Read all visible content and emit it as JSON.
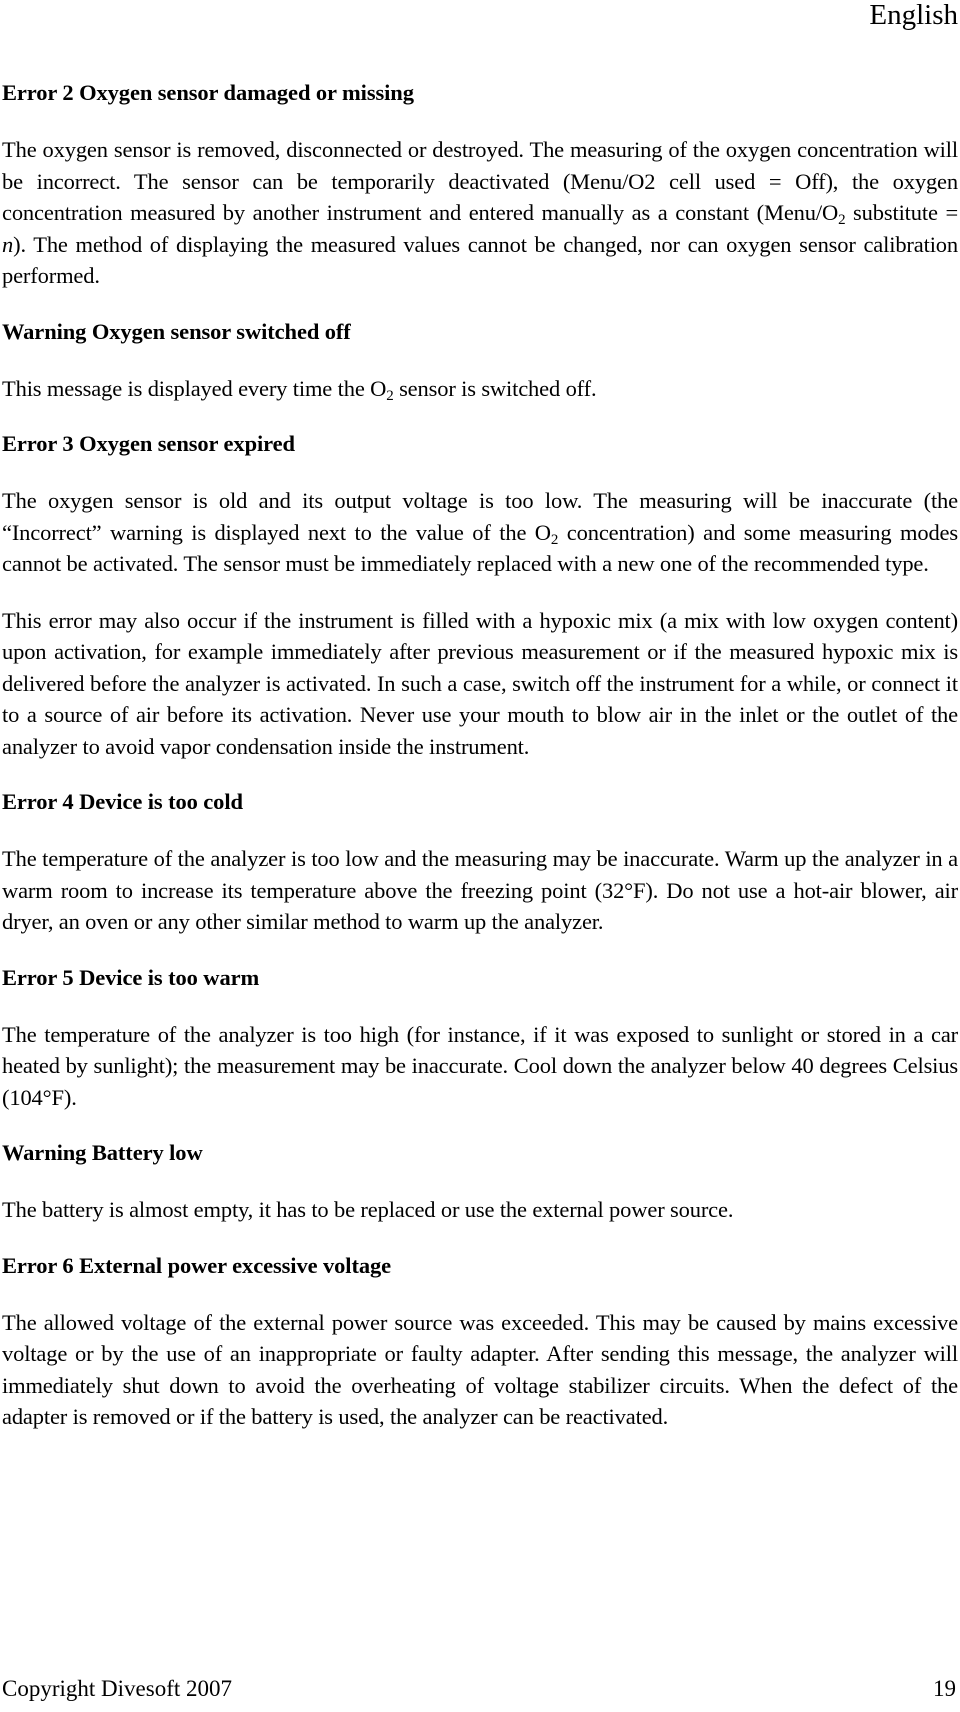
{
  "header": {
    "language": "English"
  },
  "sections": [
    {
      "heading": "Error 2 Oxygen sensor damaged or missing",
      "paragraphs": [
        {
          "p1": "The oxygen sensor is removed, disconnected or destroyed. The measuring of the oxygen concentration will be incorrect. The sensor can be temporarily deactivated (Menu/O2 cell used = Off), the oxygen concentration measured by another instrument and entered manually as a constant (Menu/O",
          "sub": "2",
          "p2": " substitute = ",
          "italic": "n",
          "p3": "). The method of displaying the measured values cannot be changed, nor can oxygen sensor calibration performed."
        }
      ]
    },
    {
      "heading": "Warning Oxygen sensor switched off",
      "paragraphs": [
        {
          "p1": "This message is displayed every time the O",
          "sub": "2",
          "p2": " sensor is switched off."
        }
      ]
    },
    {
      "heading": "Error 3 Oxygen sensor expired",
      "paragraphs": [
        {
          "p1": "The oxygen sensor is old and its output voltage is too low. The measuring will be inaccurate (the “Incorrect” warning is displayed next to the value of the O",
          "sub": "2",
          "p2": " concentration) and some measuring modes cannot be activated. The sensor must be immediately replaced with a new one of the recommended type."
        },
        {
          "p1": "This error may also occur if the instrument is filled with a hypoxic mix (a mix with low oxygen content) upon activation, for example immediately after previous measurement or if the measured hypoxic mix is delivered before the analyzer is activated. In such a case, switch off the instrument for a while, or connect it to a source of air before its activation. Never use your mouth to blow air in the inlet or the outlet of the analyzer to avoid vapor condensation inside the instrument."
        }
      ]
    },
    {
      "heading": "Error 4 Device is too cold",
      "paragraphs": [
        {
          "p1": "The temperature of the analyzer is too low and the measuring may be inaccurate. Warm up the analyzer in a warm room to increase its temperature above the freezing point (32°F). Do not use a hot-air blower, air dryer, an oven or any other similar method to warm up the analyzer."
        }
      ]
    },
    {
      "heading": "Error 5 Device is too warm",
      "paragraphs": [
        {
          "p1": "The temperature of the analyzer is too high (for instance, if it was exposed to sunlight or stored in a car heated by sunlight); the measurement may be inaccurate. Cool down the analyzer below 40 degrees Celsius (104°F)."
        }
      ]
    },
    {
      "heading": "Warning Battery low",
      "paragraphs": [
        {
          "p1": "The battery is almost empty, it has to be replaced or use the external power source."
        }
      ]
    },
    {
      "heading": "Error 6 External power excessive voltage",
      "paragraphs": [
        {
          "p1": "The allowed voltage of the external power source was exceeded. This may be caused by mains excessive voltage or by the use of an inappropriate or faulty adapter. After sending this message, the analyzer will immediately shut down to avoid the overheating of voltage stabilizer circuits. When the defect of the adapter is removed or if the battery is used, the analyzer can be reactivated."
        }
      ]
    }
  ],
  "footer": {
    "copyright": "Copyright Divesoft 2007",
    "page_number": "19"
  }
}
